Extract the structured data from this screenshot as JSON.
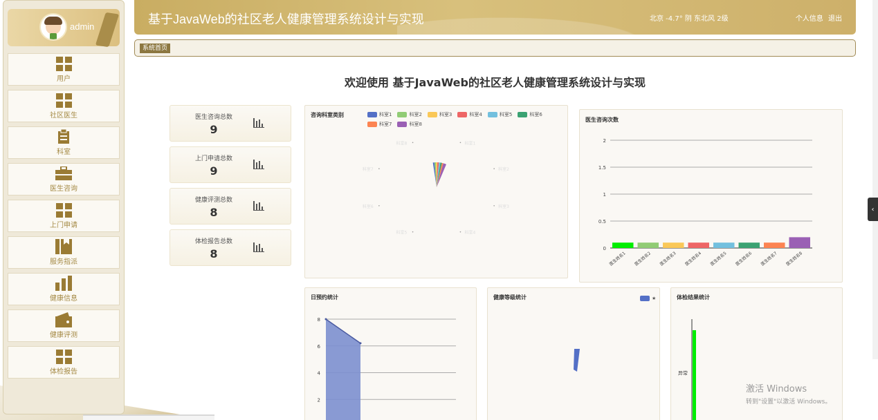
{
  "user": {
    "name": "admin"
  },
  "sidebar": {
    "items": [
      {
        "label": "用户",
        "icon": "grid-icon"
      },
      {
        "label": "社区医生",
        "icon": "grid-icon"
      },
      {
        "label": "科室",
        "icon": "clipboard-icon"
      },
      {
        "label": "医生咨询",
        "icon": "briefcase-icon"
      },
      {
        "label": "上门申请",
        "icon": "grid-icon"
      },
      {
        "label": "服务指派",
        "icon": "bookmark-icon"
      },
      {
        "label": "健康信息",
        "icon": "bar-chart-icon"
      },
      {
        "label": "健康评测",
        "icon": "wallet-icon"
      },
      {
        "label": "体检报告",
        "icon": "grid-icon"
      }
    ]
  },
  "header": {
    "title": "基于JavaWeb的社区老人健康管理系统设计与实现",
    "weather": "北京 -4.7° 阴 东北风 2级",
    "profile_link": "个人信息",
    "logout_link": "退出"
  },
  "breadcrumb": {
    "home": "系统首页"
  },
  "welcome": "欢迎使用 基于JavaWeb的社区老人健康管理系统设计与实现",
  "stats": [
    {
      "label": "医生咨询总数",
      "value": "9"
    },
    {
      "label": "上门申请总数",
      "value": "9"
    },
    {
      "label": "健康评测总数",
      "value": "8"
    },
    {
      "label": "体检报告总数",
      "value": "8"
    }
  ],
  "colors": {
    "accent": "#c9ad62",
    "accent_dark": "#8c7740",
    "palette": [
      "#5470c6",
      "#91cc75",
      "#fac858",
      "#ee6666",
      "#73c0de",
      "#3ba272",
      "#fc8452",
      "#9a60b4"
    ]
  },
  "windows_watermark": {
    "line1": "激活 Windows",
    "line2": "转到\"设置\"以激活 Windows。"
  },
  "chart_data": [
    {
      "type": "pie",
      "title": "咨询科室类别",
      "legend": [
        "科室1",
        "科室2",
        "科室3",
        "科室4",
        "科室5",
        "科室6",
        "科室7",
        "科室8"
      ],
      "labels": [
        "科室1",
        "科室2",
        "科室3",
        "科室4",
        "科室5",
        "科室6",
        "科室7",
        "科室8"
      ],
      "values": [
        1,
        1,
        1,
        1,
        1,
        1,
        1,
        2
      ]
    },
    {
      "type": "bar",
      "title": "医生咨询次数",
      "categories": [
        "医生姓名1",
        "医生姓名2",
        "医生姓名3",
        "医生姓名4",
        "医生姓名5",
        "医生姓名6",
        "医生姓名7",
        "医生姓名8"
      ],
      "values": [
        0.1,
        0.1,
        0.1,
        0.1,
        0.1,
        0.1,
        0.1,
        0.2
      ],
      "colors": [
        "#00ee00",
        "#91cc75",
        "#fac858",
        "#ee6666",
        "#73c0de",
        "#3ba272",
        "#fc8452",
        "#9a60b4"
      ],
      "yticks": [
        "0",
        "0.5",
        "1",
        "1.5",
        "2"
      ],
      "ylim": [
        0,
        2
      ]
    },
    {
      "type": "area",
      "title": "日预约统计",
      "x": [
        0,
        1
      ],
      "values": [
        8,
        6.2
      ],
      "yticks": [
        "2",
        "4",
        "6",
        "8"
      ],
      "ylim": [
        0,
        8
      ]
    },
    {
      "type": "pie",
      "title": "健康等级统计",
      "legend": [
        "★"
      ],
      "values": [
        1
      ]
    },
    {
      "type": "bar",
      "title": "体检结果统计",
      "categories": [
        "异常"
      ],
      "values": [
        1
      ]
    }
  ]
}
